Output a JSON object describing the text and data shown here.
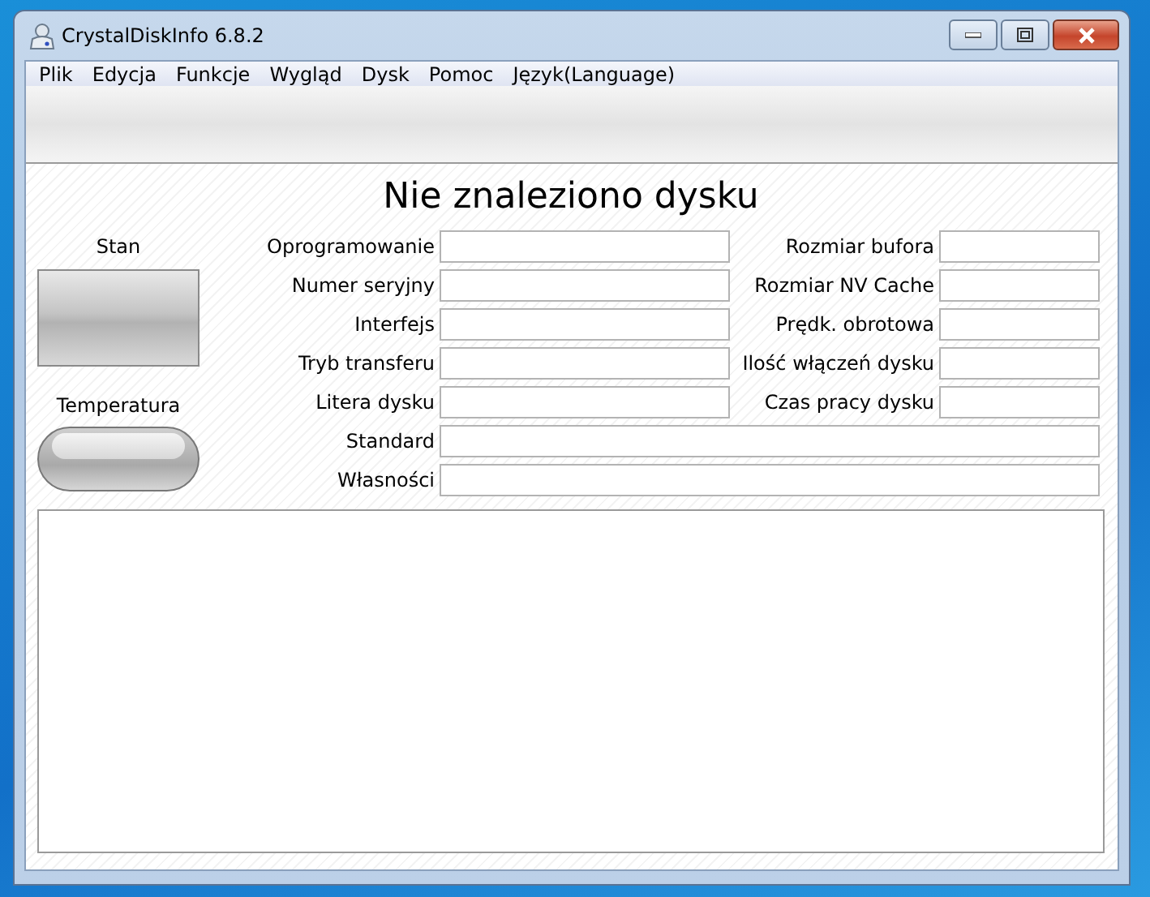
{
  "window": {
    "title": "CrystalDiskInfo 6.8.2"
  },
  "menu": [
    "Plik",
    "Edycja",
    "Funkcje",
    "Wygląd",
    "Dysk",
    "Pomoc",
    "Język(Language)"
  ],
  "heading": "Nie znaleziono dysku",
  "status": {
    "label": "Stan"
  },
  "temperature": {
    "label": "Temperatura"
  },
  "left_fields": [
    {
      "label": "Oprogramowanie"
    },
    {
      "label": "Numer seryjny"
    },
    {
      "label": "Interfejs"
    },
    {
      "label": "Tryb transferu"
    },
    {
      "label": "Litera dysku"
    }
  ],
  "right_fields": [
    {
      "label": "Rozmiar bufora"
    },
    {
      "label": "Rozmiar NV Cache"
    },
    {
      "label": "Prędk. obrotowa"
    },
    {
      "label": "Ilość włączeń dysku"
    },
    {
      "label": "Czas pracy dysku"
    }
  ],
  "wide_fields": [
    {
      "label": "Standard"
    },
    {
      "label": "Własności"
    }
  ]
}
